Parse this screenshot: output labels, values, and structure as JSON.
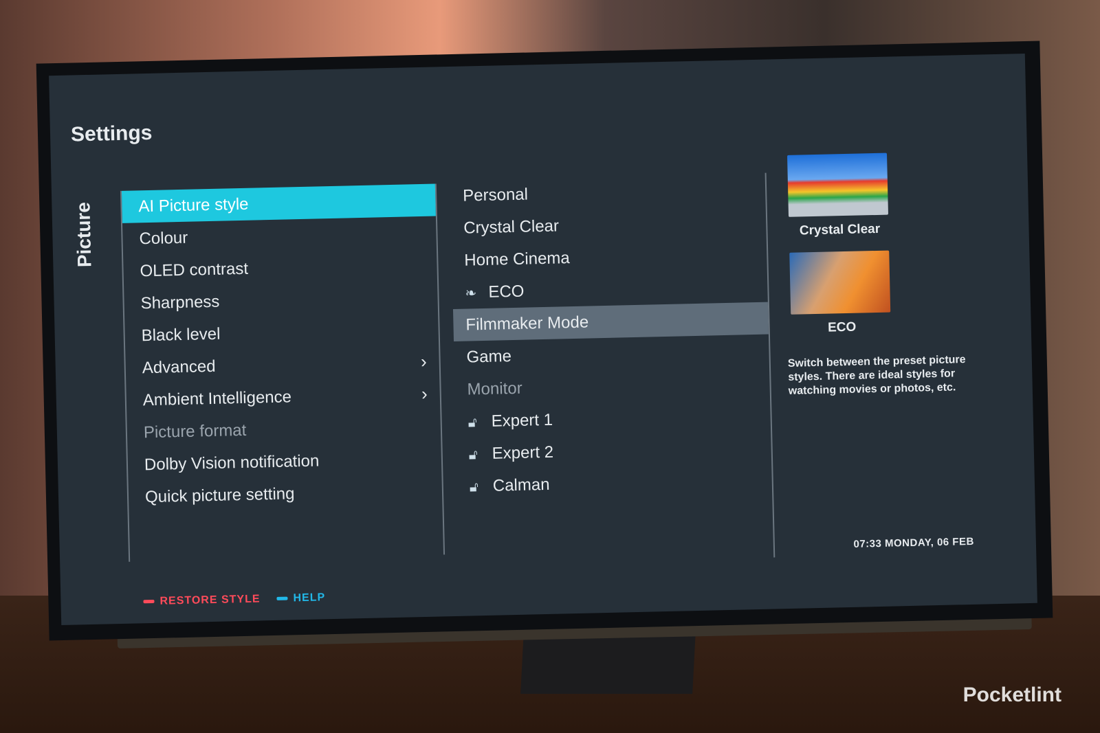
{
  "header": {
    "title": "Settings",
    "section_tab": "Picture"
  },
  "menu": {
    "items": [
      {
        "label": "AI Picture style",
        "selected": true
      },
      {
        "label": "Colour"
      },
      {
        "label": "OLED contrast"
      },
      {
        "label": "Sharpness"
      },
      {
        "label": "Black level"
      },
      {
        "label": "Advanced",
        "submenu": true
      },
      {
        "label": "Ambient Intelligence",
        "submenu": true
      },
      {
        "label": "Picture format",
        "disabled": true
      },
      {
        "label": "Dolby Vision notification"
      },
      {
        "label": "Quick picture setting"
      }
    ]
  },
  "styles": {
    "items": [
      {
        "label": "Personal"
      },
      {
        "label": "Crystal Clear"
      },
      {
        "label": "Home Cinema"
      },
      {
        "label": "ECO",
        "icon": "leaf-icon"
      },
      {
        "label": "Filmmaker Mode",
        "highlighted": true
      },
      {
        "label": "Game"
      },
      {
        "label": "Monitor",
        "disabled": true
      },
      {
        "label": "Expert 1",
        "icon": "unlock-icon"
      },
      {
        "label": "Expert 2",
        "icon": "unlock-icon"
      },
      {
        "label": "Calman",
        "icon": "unlock-icon"
      }
    ]
  },
  "preview": {
    "items": [
      {
        "caption": "Crystal Clear"
      },
      {
        "caption": "ECO"
      }
    ],
    "description": "Switch between the preset picture styles. There are ideal styles for watching movies or photos, etc."
  },
  "status": {
    "clock": "07:33 MONDAY, 06 FEB"
  },
  "footer": {
    "restore": "RESTORE STYLE",
    "help": "HELP",
    "restore_color": "#ff4b5a",
    "help_color": "#22b8e8"
  },
  "colors": {
    "accent": "#1ec8df",
    "highlight": "#5f6d7a",
    "background": "#263039"
  },
  "watermark": "Pocketlint"
}
